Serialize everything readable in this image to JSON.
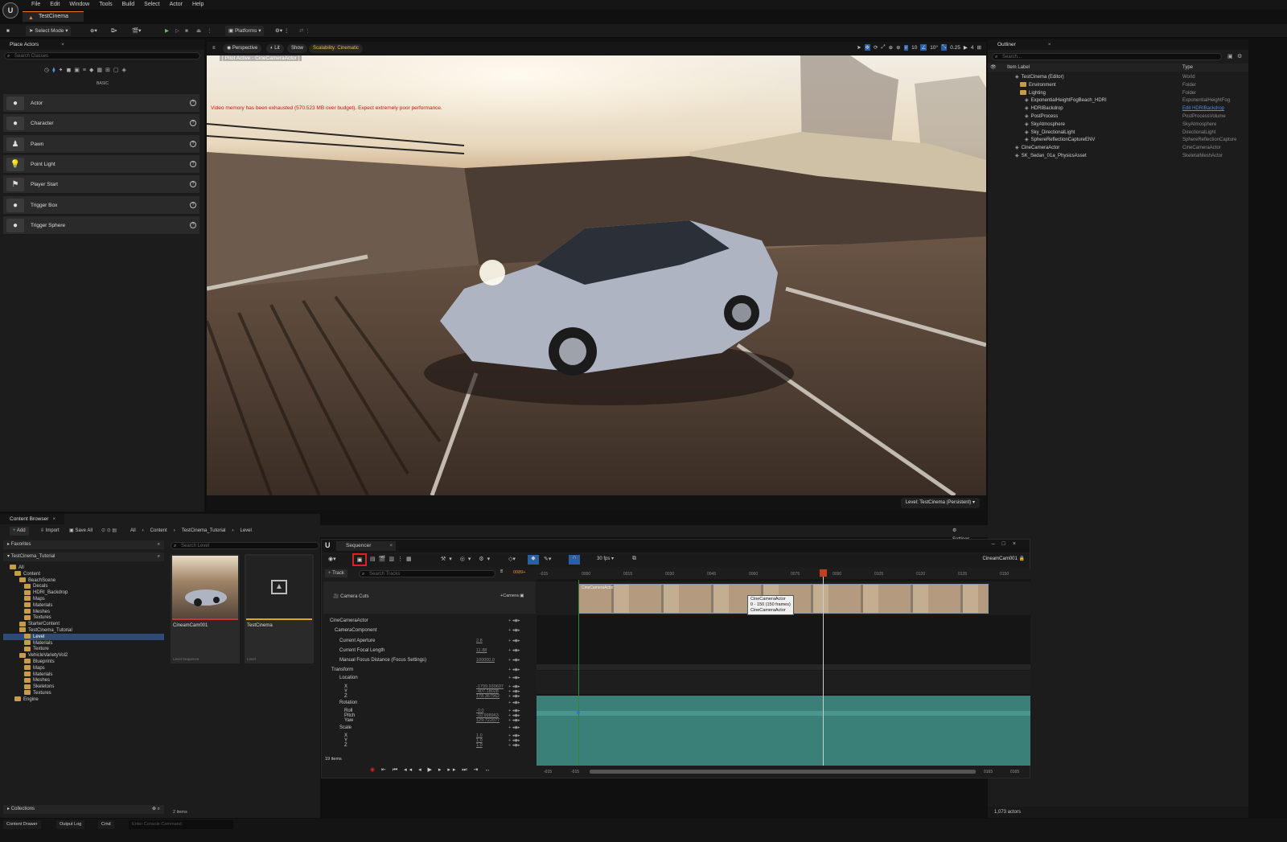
{
  "menubar": {
    "items": [
      "File",
      "Edit",
      "Window",
      "Tools",
      "Build",
      "Select",
      "Actor",
      "Help"
    ]
  },
  "title_tab": "TestCinema",
  "toolbar": {
    "select_mode": "Select Mode",
    "platforms": "Platforms"
  },
  "place_actors": {
    "title": "Place Actors",
    "search_placeholder": "Search Classes",
    "category": "BASIC",
    "items": [
      "Actor",
      "Character",
      "Pawn",
      "Point Light",
      "Player Start",
      "Trigger Box",
      "Trigger Sphere"
    ]
  },
  "viewport": {
    "perspective": "Perspective",
    "lit": "Lit",
    "show": "Show",
    "scalability": "Scalability: Cinematic",
    "pilot": "[ Pilot Active - CineCameraActor ]",
    "warning": "Video memory has been exhausted (570.523 MB over budget). Expect extremely poor performance.",
    "level": "Level: TestCinema (Persistent)",
    "grid_snap": "10",
    "rot_snap": "10°",
    "scale_snap": "0.25",
    "cam_speed": "4"
  },
  "outliner": {
    "title": "Outliner",
    "search_placeholder": "Search...",
    "col_label": "Item Label",
    "col_type": "Type",
    "rows": [
      {
        "name": "TestCinema (Editor)",
        "type": "World",
        "link": false
      },
      {
        "name": "Environment",
        "type": "Folder",
        "link": false
      },
      {
        "name": "Lighting",
        "type": "Folder",
        "link": false
      },
      {
        "name": "ExponentialHeightFogBeach_HDRI",
        "type": "ExponentialHeightFog",
        "link": false
      },
      {
        "name": "HDRIBackdrop",
        "type": "Edit HDRIBackdrop",
        "link": true
      },
      {
        "name": "PostProcess",
        "type": "PostProcessVolume",
        "link": false
      },
      {
        "name": "SkyAtmosphere",
        "type": "SkyAtmosphere",
        "link": false
      },
      {
        "name": "Sky_DirectionalLight",
        "type": "DirectionalLight",
        "link": false
      },
      {
        "name": "SphereReflectionCaptureENV",
        "type": "SphereReflectionCapture",
        "link": false
      },
      {
        "name": "CineCameraActor",
        "type": "CineCameraActor",
        "link": false
      },
      {
        "name": "SK_Sedan_01a_PhysicsAsset",
        "type": "SkeletalMeshActor",
        "link": false
      }
    ],
    "actor_count": "1,073 actors"
  },
  "content_browser": {
    "title": "Content Browser",
    "add": "Add",
    "import": "Import",
    "save_all": "Save All",
    "settings": "Settings",
    "breadcrumb": [
      "All",
      "Content",
      "TestCinema_Tutorial",
      "Level"
    ],
    "favorites": "Favorites",
    "root": "TestCinema_Tutorial",
    "search_placeholder": "Search Level",
    "tree": [
      "All",
      "Content",
      "BeachScene",
      "Decals",
      "HDRI_Backdrop",
      "Maps",
      "Materials",
      "Meshes",
      "Textures",
      "StarterContent",
      "TestCinema_Tutorial",
      "Level",
      "Materials",
      "Texture",
      "VehicleVarietyVol2",
      "Blueprints",
      "Maps",
      "Materials",
      "Meshes",
      "Skeletons",
      "Textures",
      "Engine"
    ],
    "assets": [
      {
        "name": "CineamCam001",
        "type": "Level Sequence"
      },
      {
        "name": "TestCinema",
        "type": "Level"
      }
    ],
    "collections": "Collections",
    "item_count": "2 items"
  },
  "sequencer": {
    "title": "Sequencer",
    "track_btn": "Track",
    "search_placeholder": "Search Tracks",
    "fps": "30 fps",
    "sequence_name": "CineamCam001",
    "playhead_frame": "0089+",
    "ruler_labels": [
      "-015",
      "0000",
      "0015",
      "0030",
      "0045",
      "0060",
      "0075",
      "0090",
      "0105",
      "0120",
      "0135",
      "0150"
    ],
    "camera_cuts": "Camera Cuts",
    "camera_btn": "Camera",
    "tracks": [
      {
        "label": "CineCameraActor",
        "value": ""
      },
      {
        "label": "CameraComponent",
        "value": ""
      },
      {
        "label": "Current Aperture",
        "value": "2.8"
      },
      {
        "label": "Current Focal Length",
        "value": "11.88"
      },
      {
        "label": "Manual Focus Distance (Focus Settings)",
        "value": "100000.0"
      },
      {
        "label": "Transform",
        "value": ""
      },
      {
        "label": "Location",
        "value": ""
      },
      {
        "label": "X",
        "value": "-1799.939697"
      },
      {
        "label": "Y",
        "value": "-407.18028"
      },
      {
        "label": "Z",
        "value": "178.367962"
      },
      {
        "label": "Rotation",
        "value": ""
      },
      {
        "label": "Roll",
        "value": "-0.0"
      },
      {
        "label": "Pitch",
        "value": "-10.998963"
      },
      {
        "label": "Yaw",
        "value": "129.722077"
      },
      {
        "label": "Scale",
        "value": ""
      },
      {
        "label": "X",
        "value": "1.0"
      },
      {
        "label": "Y",
        "value": "1.0"
      },
      {
        "label": "Z",
        "value": "1.0"
      }
    ],
    "item_count": "19 items",
    "clip_label": "CineCameraActor",
    "tooltip": [
      "CineCameraActor",
      "0 - 150 (150 frames)",
      "CineCameraActor"
    ],
    "range_start": "-015",
    "range_start2": "-015",
    "range_end": "0165",
    "range_end2": "0165"
  },
  "statusbar": {
    "tabs": [
      "Content Drawer",
      "Output Log",
      "Cmd"
    ],
    "cmd_placeholder": "Enter Console Command"
  }
}
